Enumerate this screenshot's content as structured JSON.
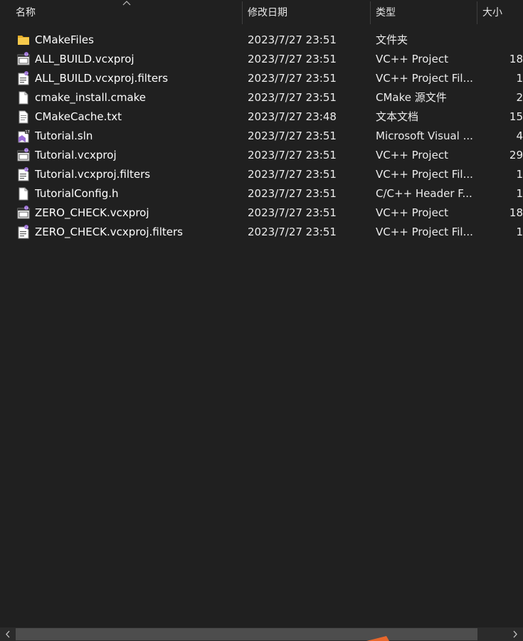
{
  "header": {
    "name": "名称",
    "date": "修改日期",
    "type": "类型",
    "size": "大小"
  },
  "files": [
    {
      "name": "CMakeFiles",
      "date": "2023/7/27 23:51",
      "type": "文件夹",
      "size": "",
      "icon": "folder-icon"
    },
    {
      "name": "ALL_BUILD.vcxproj",
      "date": "2023/7/27 23:51",
      "type": "VC++ Project",
      "size": "18",
      "icon": "vcxproj-icon"
    },
    {
      "name": "ALL_BUILD.vcxproj.filters",
      "date": "2023/7/27 23:51",
      "type": "VC++ Project Fil...",
      "size": "1",
      "icon": "filters-icon"
    },
    {
      "name": "cmake_install.cmake",
      "date": "2023/7/27 23:51",
      "type": "CMake 源文件",
      "size": "2",
      "icon": "file-icon"
    },
    {
      "name": "CMakeCache.txt",
      "date": "2023/7/27 23:48",
      "type": "文本文档",
      "size": "15",
      "icon": "text-file-icon"
    },
    {
      "name": "Tutorial.sln",
      "date": "2023/7/27 23:51",
      "type": "Microsoft Visual ...",
      "size": "4",
      "icon": "sln-icon"
    },
    {
      "name": "Tutorial.vcxproj",
      "date": "2023/7/27 23:51",
      "type": "VC++ Project",
      "size": "29",
      "icon": "vcxproj-icon"
    },
    {
      "name": "Tutorial.vcxproj.filters",
      "date": "2023/7/27 23:51",
      "type": "VC++ Project Fil...",
      "size": "1",
      "icon": "filters-icon"
    },
    {
      "name": "TutorialConfig.h",
      "date": "2023/7/27 23:51",
      "type": "C/C++ Header F...",
      "size": "1",
      "icon": "blank-file-icon"
    },
    {
      "name": "ZERO_CHECK.vcxproj",
      "date": "2023/7/27 23:51",
      "type": "VC++ Project",
      "size": "18",
      "icon": "vcxproj-icon"
    },
    {
      "name": "ZERO_CHECK.vcxproj.filters",
      "date": "2023/7/27 23:51",
      "type": "VC++ Project Fil...",
      "size": "1",
      "icon": "filters-icon"
    }
  ],
  "colors": {
    "background": "#202020",
    "text": "#ffffff",
    "folder": "#f3c341",
    "vs_purple": "#9b6fd6",
    "scroll_thumb": "#4d4d4d"
  }
}
